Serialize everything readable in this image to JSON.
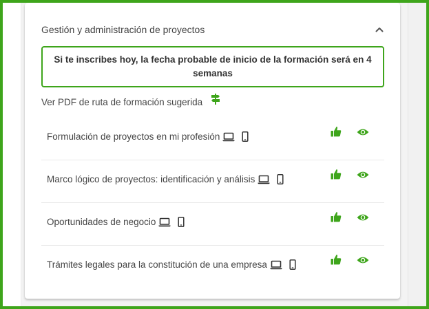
{
  "card": {
    "title": "Gestión y administración de proyectos",
    "collapse_icon": "chevron-up-icon"
  },
  "notice": {
    "text": "Si te inscribes hoy, la fecha probable de inicio de la formación será en 4 semanas"
  },
  "pdf_link": {
    "label": "Ver PDF de ruta de formación sugerida",
    "icon": "signpost-icon"
  },
  "courses": [
    {
      "name": "Formulación de proyectos en mi profesión"
    },
    {
      "name": "Marco lógico de proyectos: identificación y análisis"
    },
    {
      "name": "Oportunidades de negocio"
    },
    {
      "name": "Trámites legales para la constitución de una empresa"
    }
  ],
  "course_icons": {
    "device_1": "laptop-icon",
    "device_2": "mobile-phone-icon",
    "action_1": "thumbs-up-icon",
    "action_2": "eye-icon"
  },
  "colors": {
    "accent": "#3ea51b",
    "text": "#444444",
    "frame": "#3ea51b"
  }
}
